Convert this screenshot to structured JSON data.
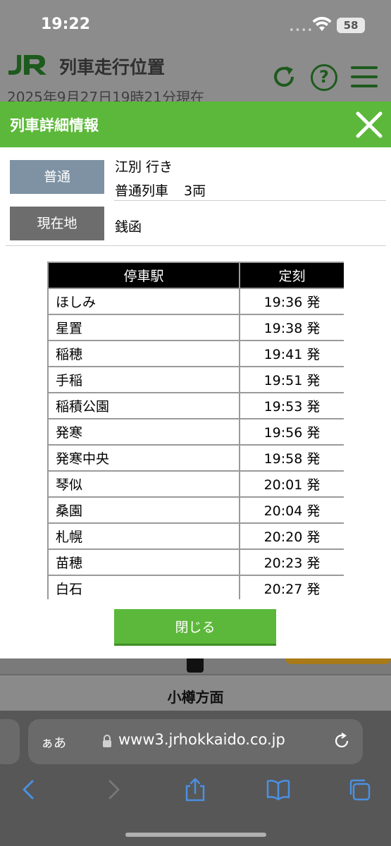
{
  "status_bar": {
    "time": "19:22",
    "battery": "58"
  },
  "background": {
    "app_title": "列車走行位置",
    "updated_at": "2025年9月27日19時21分現在",
    "direction_label": "小樽方面"
  },
  "modal": {
    "title": "列車詳細情報",
    "train_type": "普通",
    "destination": "江別 行き",
    "train_kind": "普通列車",
    "cars": "3両",
    "location_label": "現在地",
    "location": "銭函",
    "table_headers": [
      "停車駅",
      "定刻"
    ],
    "stops": [
      {
        "station": "ほしみ",
        "time": "19:36 発"
      },
      {
        "station": "星置",
        "time": "19:38 発"
      },
      {
        "station": "稲穂",
        "time": "19:41 発"
      },
      {
        "station": "手稲",
        "time": "19:51 発"
      },
      {
        "station": "稲積公園",
        "time": "19:53 発"
      },
      {
        "station": "発寒",
        "time": "19:56 発"
      },
      {
        "station": "発寒中央",
        "time": "19:58 発"
      },
      {
        "station": "琴似",
        "time": "20:01 発"
      },
      {
        "station": "桑園",
        "time": "20:04 発"
      },
      {
        "station": "札幌",
        "time": "20:20 発"
      },
      {
        "station": "苗穂",
        "time": "20:23 発"
      },
      {
        "station": "白石",
        "time": "20:27 発"
      }
    ],
    "close_button_label": "閉じる"
  },
  "browser": {
    "aa_label": "ぁあ",
    "url": "www3.jrhokkaido.co.jp"
  },
  "colors": {
    "accent_green": "#5cb83a",
    "train_type_badge": "#7e92a3",
    "location_badge": "#6d6d6d",
    "safari_blue": "#4a90e2"
  }
}
